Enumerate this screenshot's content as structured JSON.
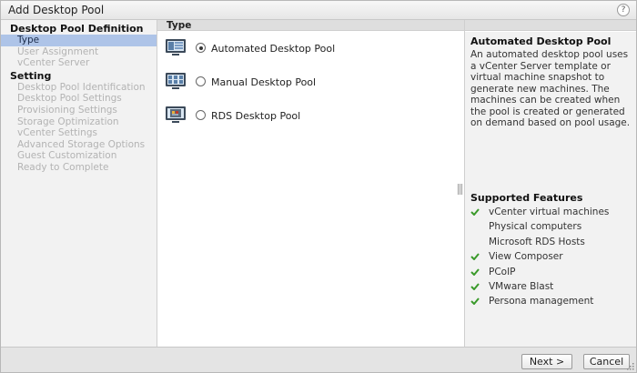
{
  "dialog": {
    "title": "Add Desktop Pool",
    "help_label": "?"
  },
  "nav": {
    "section1_header": "Desktop Pool Definition",
    "section1_items": [
      {
        "label": "Type",
        "active": true
      },
      {
        "label": "User Assignment",
        "active": false
      },
      {
        "label": "vCenter Server",
        "active": false
      }
    ],
    "section2_header": "Setting",
    "section2_items": [
      {
        "label": "Desktop Pool Identification"
      },
      {
        "label": "Desktop Pool Settings"
      },
      {
        "label": "Provisioning Settings"
      },
      {
        "label": "Storage Optimization"
      },
      {
        "label": "vCenter Settings"
      },
      {
        "label": "Advanced Storage Options"
      },
      {
        "label": "Guest Customization"
      },
      {
        "label": "Ready to Complete"
      }
    ]
  },
  "type_panel": {
    "header": "Type",
    "options": [
      {
        "label": "Automated Desktop Pool",
        "selected": true,
        "icon": "automated-pool-icon"
      },
      {
        "label": "Manual Desktop Pool",
        "selected": false,
        "icon": "manual-pool-icon"
      },
      {
        "label": "RDS Desktop Pool",
        "selected": false,
        "icon": "rds-pool-icon"
      }
    ]
  },
  "details": {
    "title": "Automated Desktop Pool",
    "description": "An automated desktop pool uses a vCenter Server template or virtual machine snapshot to generate new machines. The machines can be created when the pool is created or generated on demand based on pool usage.",
    "features_title": "Supported Features",
    "features": [
      {
        "label": "vCenter virtual machines",
        "supported": true
      },
      {
        "label": "Physical computers",
        "supported": false
      },
      {
        "label": "Microsoft RDS Hosts",
        "supported": false
      },
      {
        "label": "View Composer",
        "supported": true
      },
      {
        "label": "PCoIP",
        "supported": true
      },
      {
        "label": "VMware Blast",
        "supported": true
      },
      {
        "label": "Persona management",
        "supported": true
      }
    ]
  },
  "footer": {
    "next_label": "Next >",
    "cancel_label": "Cancel"
  },
  "colors": {
    "active_nav_bg": "#aec4e8",
    "check_green": "#3a9a2a",
    "disabled_text": "#b3b3b3"
  }
}
